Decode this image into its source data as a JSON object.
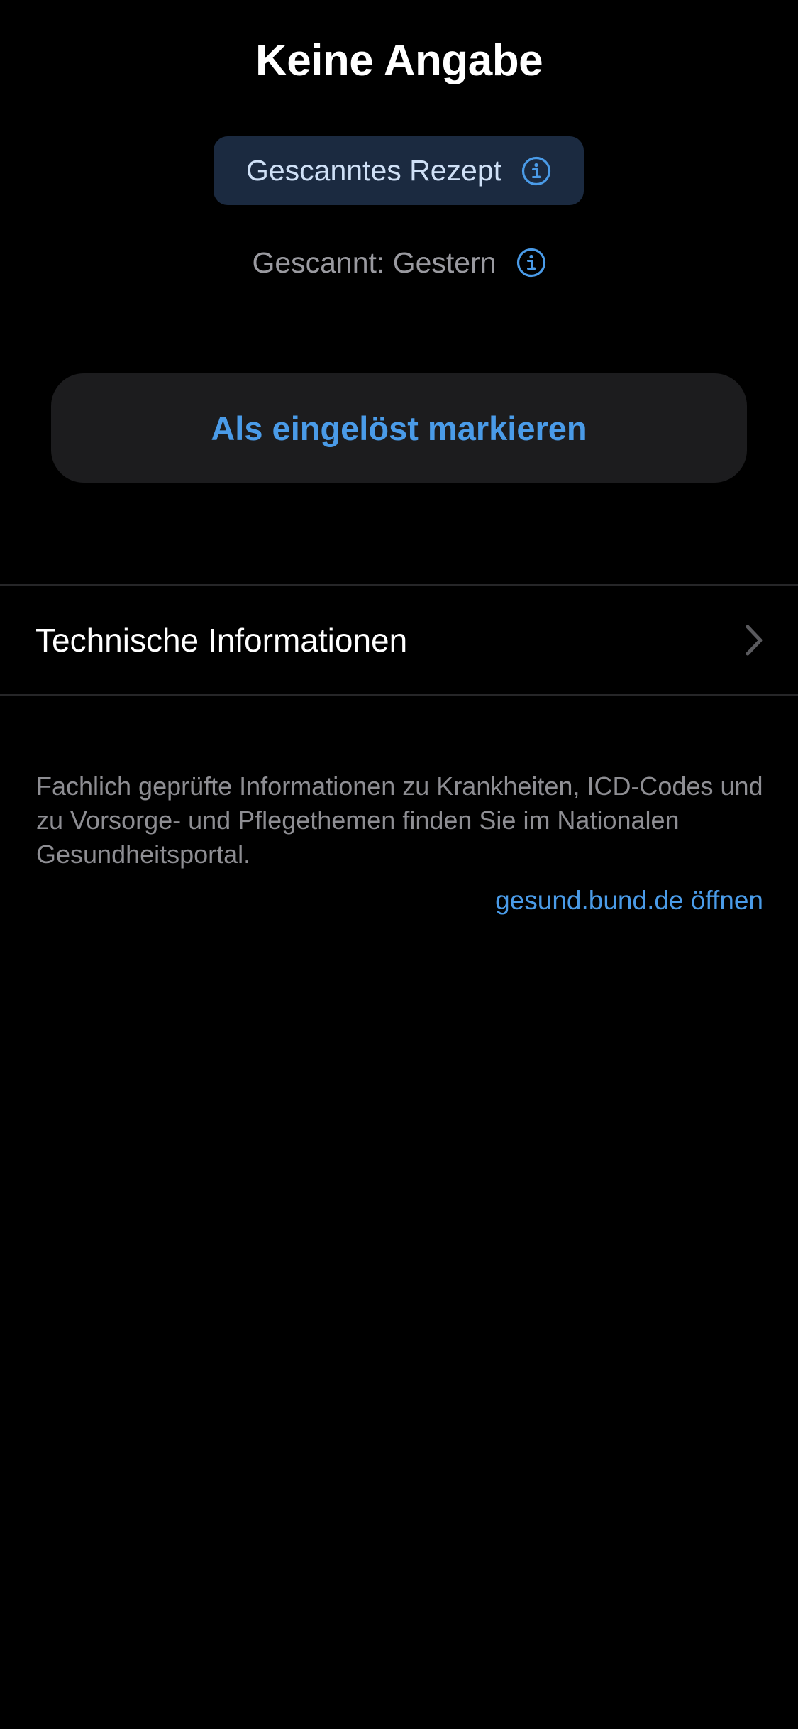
{
  "title": "Keine Angabe",
  "source_chip": {
    "label": "Gescanntes Rezept",
    "icon": "info-circle-icon"
  },
  "scan_status": {
    "label": "Gescannt: Gestern",
    "icon": "info-circle-icon"
  },
  "primary_action": {
    "label": "Als eingelöst markieren"
  },
  "technical_info": {
    "label": "Technische Informationen",
    "icon": "chevron-right-icon"
  },
  "footer": {
    "text": "Fachlich geprüfte Informationen zu Krankheiten, ICD-Codes und zu Vorsorge- und Pflegethemen finden Sie im Nationalen Gesundheitsportal.",
    "link_label": "gesund.bund.de öffnen"
  },
  "colors": {
    "background": "#000000",
    "accent": "#4a9be8",
    "chip_background": "#1b2a40",
    "button_background": "#1c1c1e",
    "secondary_text": "#8e8e93"
  }
}
